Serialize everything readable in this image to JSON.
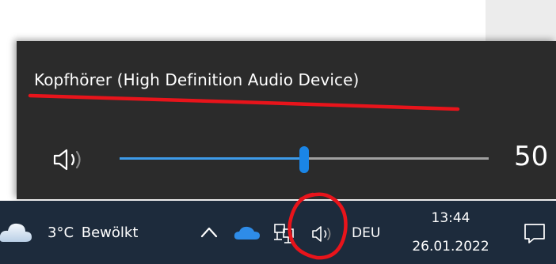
{
  "flyout": {
    "device_name": "Kopfhörer (High Definition Audio Device)",
    "volume": 50,
    "volume_label": "50"
  },
  "taskbar": {
    "weather_text": "3°C Bewölkt",
    "language": "DEU",
    "time": "13:44",
    "date": "26.01.2022"
  },
  "icons": {
    "flyout_speaker": "speaker-icon",
    "weather": "cloud-icon",
    "chevron": "chevron-up-icon",
    "onedrive": "onedrive-cloud-icon",
    "network": "network-icon",
    "volume": "speaker-icon",
    "notifications": "notification-icon"
  },
  "colors": {
    "flyout_bg": "#2b2b2b",
    "accent": "#1a85e6",
    "taskbar_bg": "#1d2b3c",
    "annotation": "#e8141b"
  }
}
